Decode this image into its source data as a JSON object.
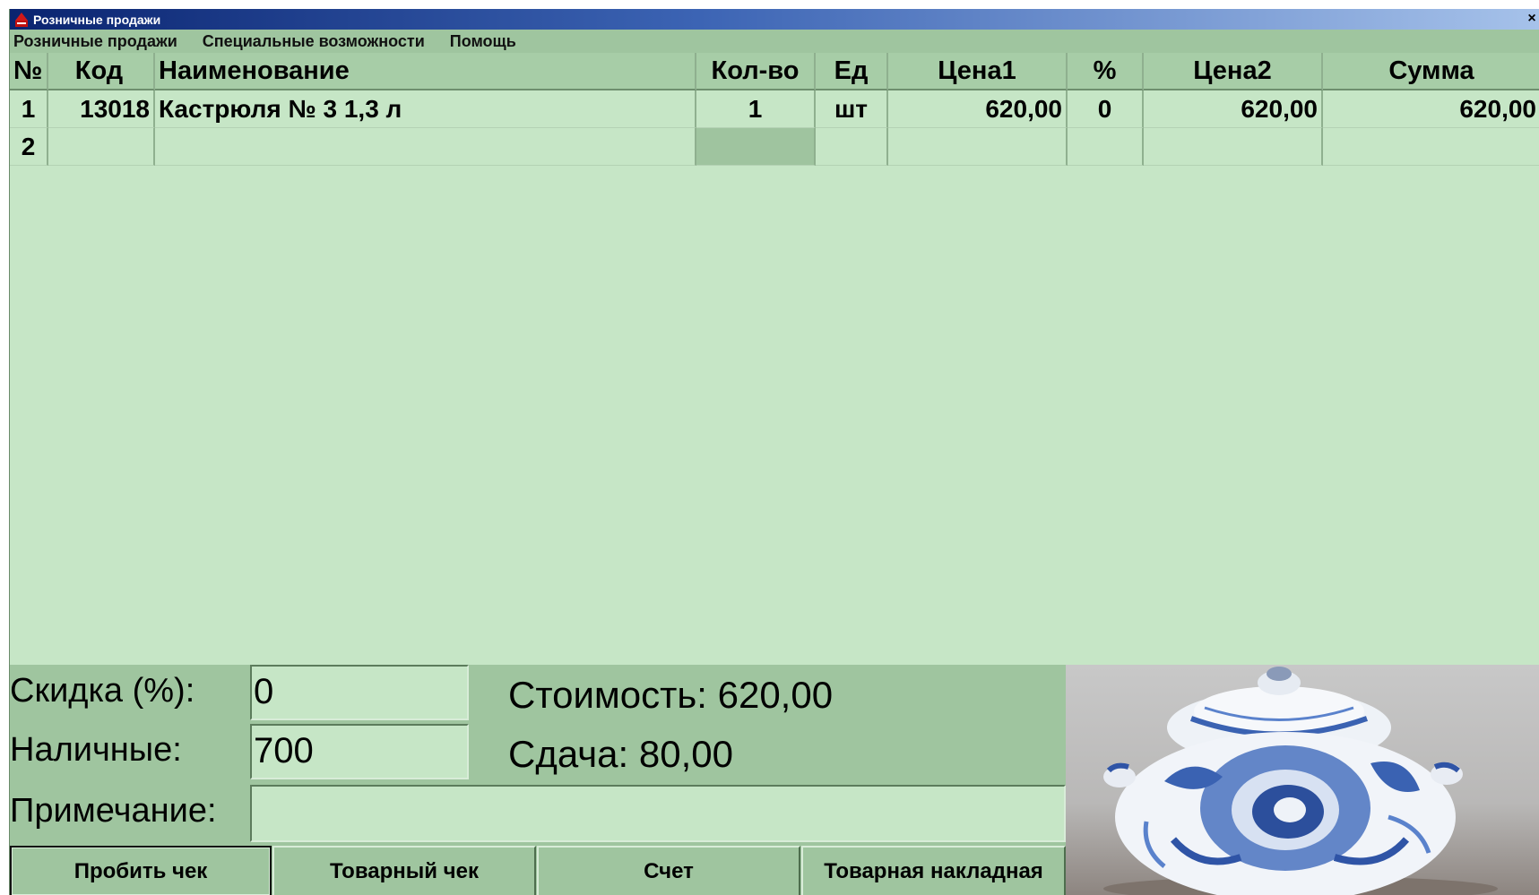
{
  "window": {
    "title": "Розничные продажи",
    "close_symbol": "×"
  },
  "menu": [
    "Розничные продажи",
    "Специальные возможности",
    "Помощь"
  ],
  "table": {
    "columns": [
      "№",
      "Код",
      "Наименование",
      "Кол-во",
      "Ед",
      "Цена1",
      "%",
      "Цена2",
      "Сумма"
    ],
    "rows": [
      {
        "num": "1",
        "code": "13018",
        "name": "Кастрюля № 3 1,3 л",
        "qty": "1",
        "unit": "шт",
        "price1": "620,00",
        "pct": "0",
        "price2": "620,00",
        "sum": "620,00"
      },
      {
        "num": "2",
        "code": "",
        "name": "",
        "qty": "",
        "unit": "",
        "price1": "",
        "pct": "",
        "price2": "",
        "sum": ""
      }
    ]
  },
  "form": {
    "discount_label": "Скидка (%):",
    "discount_value": "0",
    "cash_label": "Наличные:",
    "cash_value": "700",
    "note_label": "Примечание:",
    "note_value": ""
  },
  "totals": {
    "cost": "Стоимость: 620,00",
    "change": "Сдача: 80,00"
  },
  "buttons": {
    "print_receipt": "Пробить чек",
    "sales_receipt": "Товарный чек",
    "invoice": "Счет",
    "waybill": "Товарная накладная"
  },
  "colors": {
    "background": "#c6e6c6",
    "panel": "#9fc59f",
    "titlebar_start": "#0a2470",
    "titlebar_end": "#a6c2ea"
  }
}
